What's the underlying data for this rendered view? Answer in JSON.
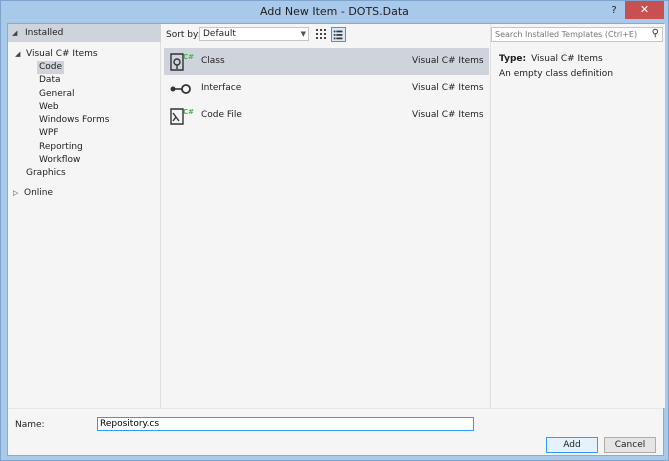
{
  "window": {
    "title": "Add New Item - DOTS.Data",
    "help": "?",
    "close": "✕"
  },
  "tree": {
    "header": "Installed",
    "root": "Visual C# Items",
    "children": [
      "Code",
      "Data",
      "General",
      "Web",
      "Windows Forms",
      "WPF",
      "Reporting",
      "Workflow"
    ],
    "graphics": "Graphics",
    "online": "Online"
  },
  "toolbar": {
    "sort_label": "Sort by:",
    "sort_value": "Default"
  },
  "items": [
    {
      "name": "Class",
      "category": "Visual C# Items"
    },
    {
      "name": "Interface",
      "category": "Visual C# Items"
    },
    {
      "name": "Code File",
      "category": "Visual C# Items"
    }
  ],
  "detail": {
    "search_placeholder": "Search Installed Templates (Ctrl+E)",
    "type_label": "Type:",
    "type_value": "Visual C# Items",
    "description": "An empty class definition"
  },
  "bottom": {
    "name_label": "Name:",
    "name_value": "Repository.cs",
    "add": "Add",
    "cancel": "Cancel"
  },
  "colors": {
    "accent": "#3399ff",
    "selection": "#cfd3dc",
    "close": "#c75050",
    "icon_green": "#4caf50"
  }
}
